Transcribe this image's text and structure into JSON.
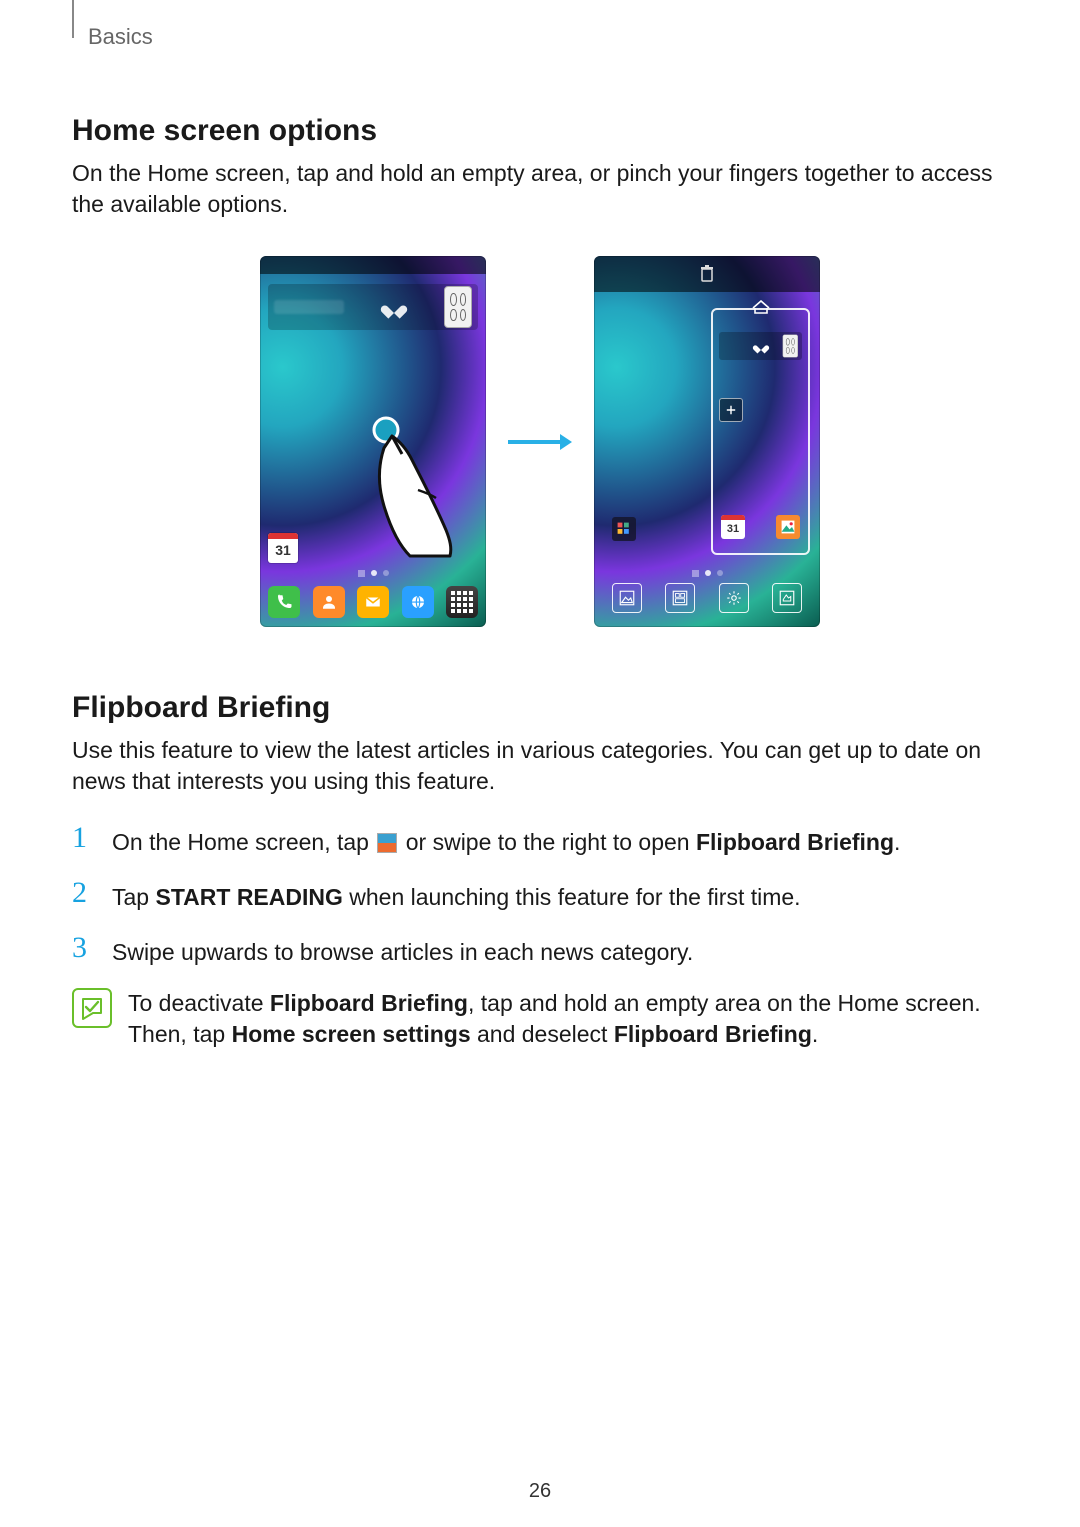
{
  "header": {
    "section": "Basics"
  },
  "page_number": "26",
  "section1": {
    "heading": "Home screen options",
    "body": "On the Home screen, tap and hold an empty area, or pinch your fingers together to access the available options."
  },
  "figure": {
    "calendar_day": "31",
    "calendar_day_b": "31"
  },
  "section2": {
    "heading": "Flipboard Briefing",
    "body": "Use this feature to view the latest articles in various categories. You can get up to date on news that interests you using this feature."
  },
  "steps": {
    "s1a": "On the Home screen, tap ",
    "s1b": " or swipe to the right to open ",
    "s1c": "Flipboard Briefing",
    "s1d": ".",
    "s2a": "Tap ",
    "s2b": "START READING",
    "s2c": " when launching this feature for the first time.",
    "s3": "Swipe upwards to browse articles in each news category."
  },
  "note": {
    "a": "To deactivate ",
    "b": "Flipboard Briefing",
    "c": ", tap and hold an empty area on the Home screen. Then, tap ",
    "d": "Home screen settings",
    "e": " and deselect ",
    "f": "Flipboard Briefing",
    "g": "."
  },
  "nums": {
    "n1": "1",
    "n2": "2",
    "n3": "3"
  }
}
